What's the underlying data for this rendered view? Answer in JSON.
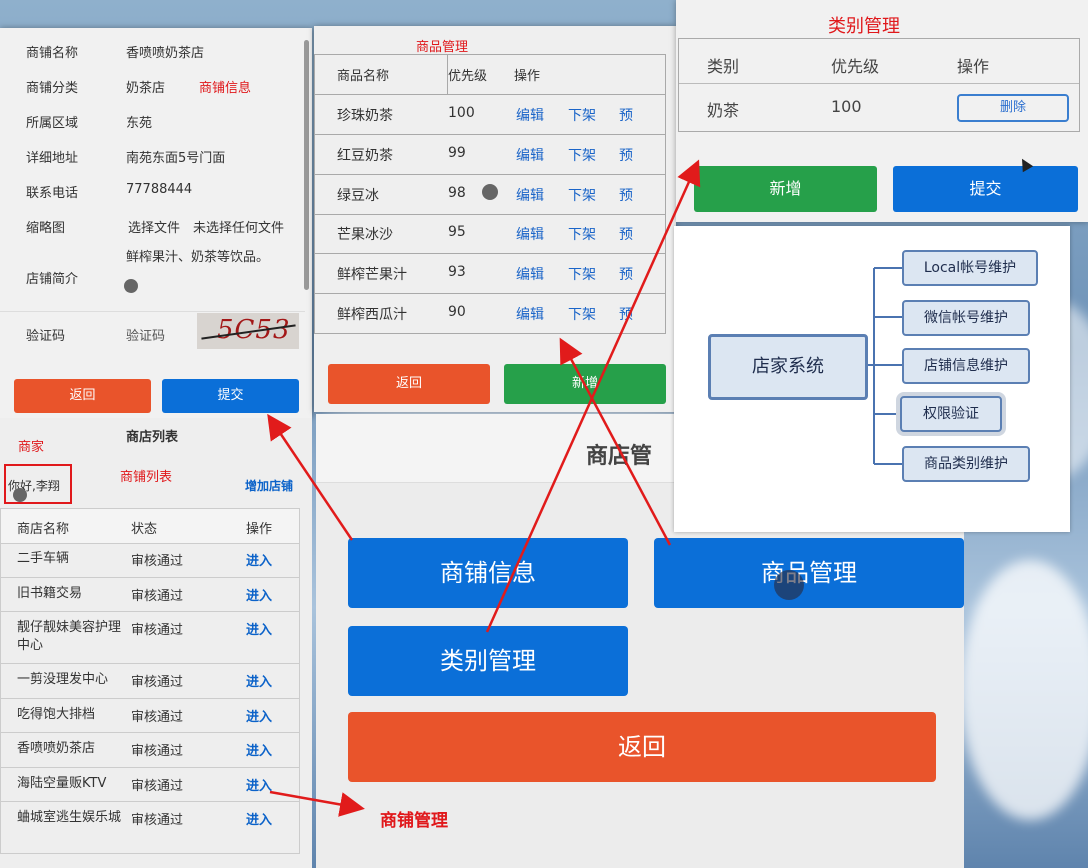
{
  "shop_info": {
    "rows": [
      {
        "label": "商铺名称",
        "value": "香喷喷奶茶店"
      },
      {
        "label": "商铺分类",
        "value": "奶茶店"
      },
      {
        "label": "所属区域",
        "value": "东苑"
      },
      {
        "label": "详细地址",
        "value": "南苑东面5号门面"
      },
      {
        "label": "联系电话",
        "value": "77788444"
      }
    ],
    "thumb_label": "缩略图",
    "file_button": "选择文件",
    "file_status": "未选择任何文件",
    "intro_label": "店铺简介",
    "intro_value": "鲜榨果汁、奶茶等饮品。",
    "captcha_label": "验证码",
    "captcha_placeholder": "验证码",
    "captcha_text": "5C53",
    "back": "返回",
    "submit": "提交",
    "note": "商铺信息"
  },
  "product_mgmt": {
    "title": "商品管理",
    "headers": [
      "商品名称",
      "优先级",
      "操作"
    ],
    "rows": [
      {
        "name": "珍珠奶茶",
        "priority": "100"
      },
      {
        "name": "红豆奶茶",
        "priority": "99"
      },
      {
        "name": "绿豆冰",
        "priority": "98"
      },
      {
        "name": "芒果冰沙",
        "priority": "95"
      },
      {
        "name": "鲜榨芒果汁",
        "priority": "93"
      },
      {
        "name": "鲜榨西瓜汁",
        "priority": "90"
      }
    ],
    "edit": "编辑",
    "offshelf": "下架",
    "preview": "预",
    "back": "返回",
    "add": "新增"
  },
  "category_mgmt": {
    "title": "类别管理",
    "headers": [
      "类别",
      "优先级",
      "操作"
    ],
    "row": {
      "name": "奶茶",
      "priority": "100",
      "delete": "删除"
    },
    "add": "新增",
    "submit": "提交"
  },
  "diagram": {
    "root": "店家系统",
    "children": [
      "Local帐号维护",
      "微信帐号维护",
      "店铺信息维护",
      "权限验证",
      "商品类别维护"
    ]
  },
  "shop_list": {
    "merchant_note": "商家",
    "header_partial": "商店列表",
    "list_note": "商铺列表",
    "greeting": "你好,李翔",
    "add_shop": "增加店铺",
    "headers": [
      "商店名称",
      "状态",
      "操作"
    ],
    "rows": [
      {
        "name": "二手车辆",
        "status": "审核通过",
        "op": "进入"
      },
      {
        "name": "旧书籍交易",
        "status": "审核通过",
        "op": "进入"
      },
      {
        "name": "靓仔靓妹美容护理中心",
        "status": "审核通过",
        "op": "进入"
      },
      {
        "name": "一剪没理发中心",
        "status": "审核通过",
        "op": "进入"
      },
      {
        "name": "吃得饱大排档",
        "status": "审核通过",
        "op": "进入"
      },
      {
        "name": "香喷喷奶茶店",
        "status": "审核通过",
        "op": "进入"
      },
      {
        "name": "海陆空量贩KTV",
        "status": "审核通过",
        "op": "进入"
      },
      {
        "name": "蛐城室逃生娱乐城",
        "status": "审核通过",
        "op": "进入"
      }
    ]
  },
  "shop_mgmt": {
    "title_partial": "商店管",
    "btn_shop_info": "商铺信息",
    "btn_product": "商品管理",
    "btn_category": "类别管理",
    "btn_back": "返回",
    "annotation": "商铺管理"
  },
  "colors": {
    "red": "#e9542b",
    "blue": "#0b6fd8",
    "green": "#26a04a",
    "note_red": "#e0181b"
  }
}
